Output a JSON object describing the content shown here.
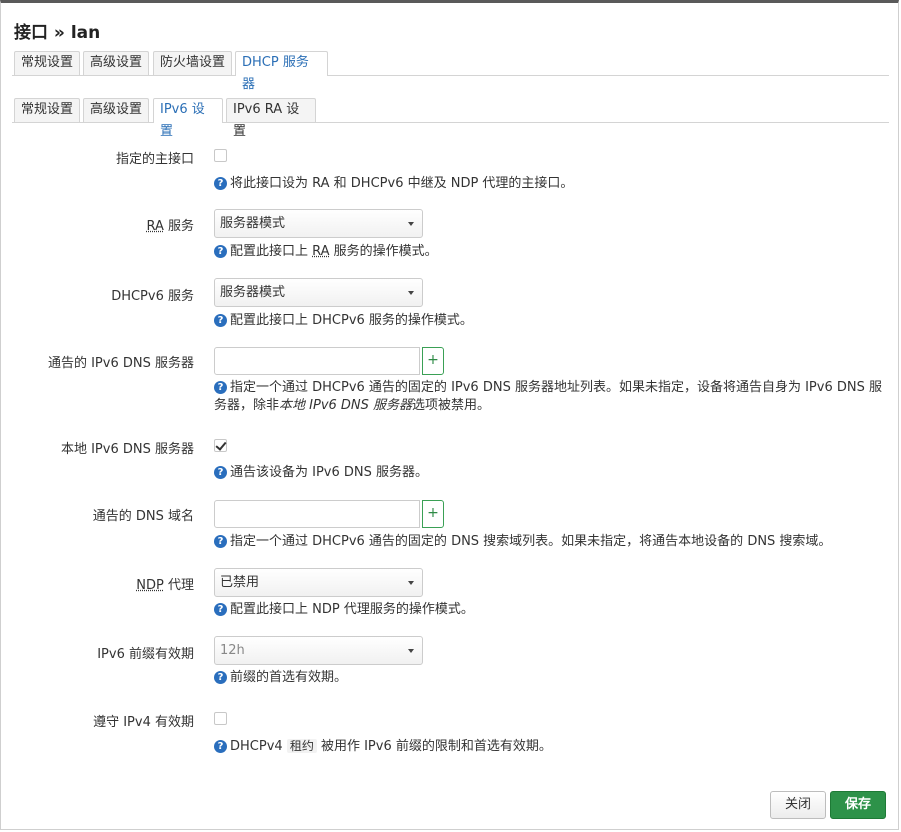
{
  "title": "接口 » lan",
  "main_tabs": [
    "常规设置",
    "高级设置",
    "防火墙设置",
    "DHCP 服务器"
  ],
  "sub_tabs": [
    "常规设置",
    "高级设置",
    "IPv6 设置",
    "IPv6 RA 设置"
  ],
  "fields": {
    "master": {
      "label": "指定的主接口",
      "help": "将此接口设为 RA 和 DHCPv6 中继及 NDP 代理的主接口。"
    },
    "ra": {
      "label_abbr": "RA",
      "label_rest": " 服务",
      "value": "服务器模式",
      "help_pre": "配置此接口上 ",
      "help_abbr": "RA",
      "help_post": " 服务的操作模式。"
    },
    "dhcpv6": {
      "label": "DHCPv6 服务",
      "value": "服务器模式",
      "help": "配置此接口上 DHCPv6 服务的操作模式。"
    },
    "dns_servers": {
      "label": "通告的 IPv6 DNS 服务器",
      "add": "+",
      "help_pre": "指定一个通过 DHCPv6 通告的固定的 IPv6 DNS 服务器地址列表。如果未指定，设备将通告自身为 IPv6 DNS 服务器，除非",
      "help_em": "本地 IPv6 DNS 服务器",
      "help_post": "选项被禁用。"
    },
    "local_dns": {
      "label": "本地 IPv6 DNS 服务器",
      "help": "通告该设备为 IPv6 DNS 服务器。"
    },
    "dns_domain": {
      "label": "通告的 DNS 域名",
      "add": "+",
      "help": "指定一个通过 DHCPv6 通告的固定的 DNS 搜索域列表。如果未指定，将通告本地设备的 DNS 搜索域。"
    },
    "ndp": {
      "label_abbr": "NDP",
      "label_rest": " 代理",
      "value": "已禁用",
      "help": "配置此接口上 NDP 代理服务的操作模式。"
    },
    "prefix_lifetime": {
      "label": "IPv6 前缀有效期",
      "value": "12h",
      "help": "前缀的首选有效期。"
    },
    "ipv4_lifetime": {
      "label": "遵守 IPv4 有效期",
      "help_pre": "DHCPv4 ",
      "help_code": "租约",
      "help_post": " 被用作 IPv6 前缀的限制和首选有效期。"
    }
  },
  "help_icon_glyph": "?",
  "buttons": {
    "close": "关闭",
    "save": "保存"
  },
  "colors": {
    "active_tab": "#2b6fb6",
    "help_icon": "#2a6ebd",
    "save_button": "#2d9249",
    "add_button": "#2e8b46"
  }
}
